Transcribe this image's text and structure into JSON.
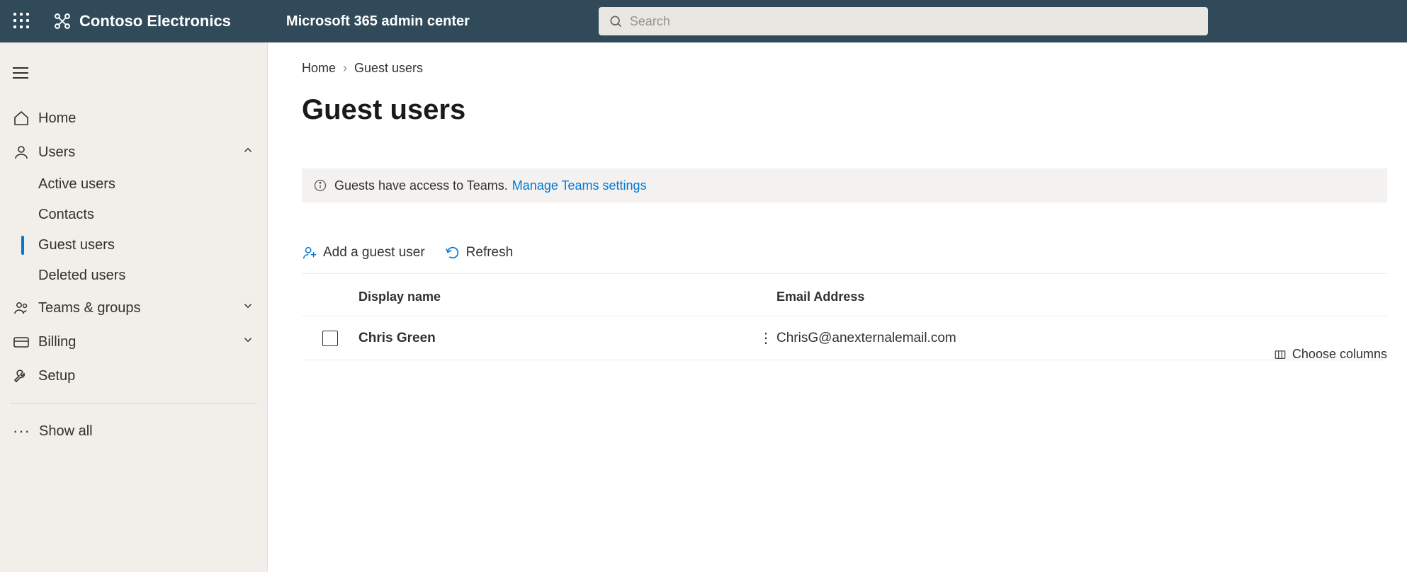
{
  "header": {
    "org_name": "Contoso Electronics",
    "app_name": "Microsoft 365 admin center",
    "search_placeholder": "Search"
  },
  "sidebar": {
    "items": [
      {
        "label": "Home"
      },
      {
        "label": "Users"
      },
      {
        "label": "Teams & groups"
      },
      {
        "label": "Billing"
      },
      {
        "label": "Setup"
      }
    ],
    "users_sub": [
      {
        "label": "Active users"
      },
      {
        "label": "Contacts"
      },
      {
        "label": "Guest users"
      },
      {
        "label": "Deleted users"
      }
    ],
    "show_all": "Show all"
  },
  "breadcrumb": {
    "home": "Home",
    "current": "Guest users"
  },
  "page": {
    "title": "Guest users",
    "banner_text": "Guests have access to Teams.",
    "banner_link": "Manage Teams settings"
  },
  "commands": {
    "add": "Add a guest user",
    "refresh": "Refresh"
  },
  "table": {
    "headers": {
      "display_name": "Display name",
      "email": "Email Address"
    },
    "choose_columns": "Choose columns",
    "rows": [
      {
        "name": "Chris  Green",
        "email": "ChrisG@anexternalemail.com"
      }
    ]
  }
}
